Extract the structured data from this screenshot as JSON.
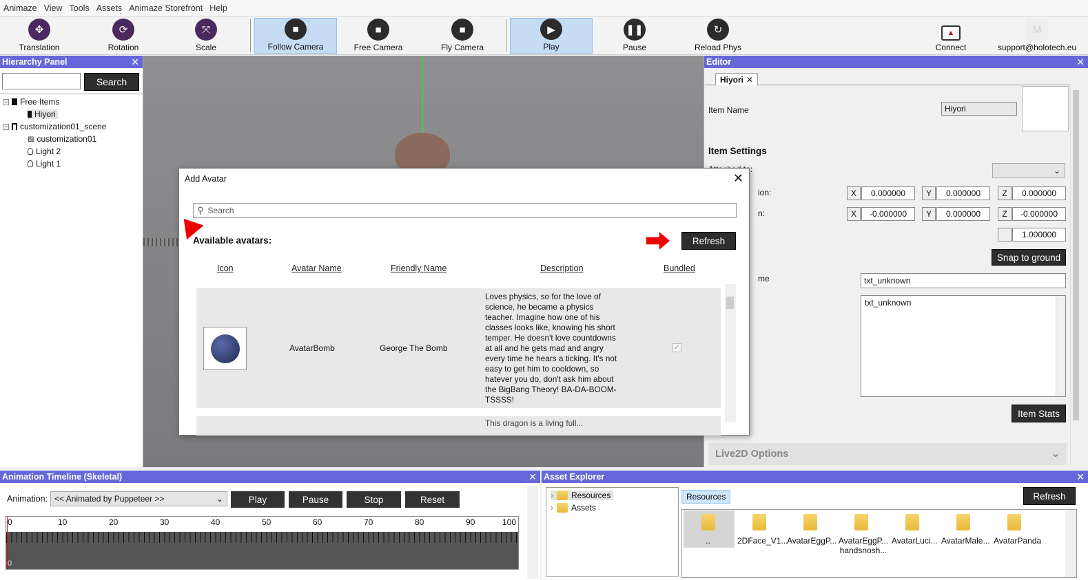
{
  "menu": [
    "Animaze",
    "View",
    "Tools",
    "Assets",
    "Animaze Storefront",
    "Help"
  ],
  "toolbar": {
    "translation": "Translation",
    "rotation": "Rotation",
    "scale": "Scale",
    "follow_camera": "Follow Camera",
    "free_camera": "Free Camera",
    "fly_camera": "Fly Camera",
    "play": "Play",
    "pause": "Pause",
    "reload_phys": "Reload Phys",
    "connect": "Connect",
    "user": "support@holotech.eu"
  },
  "hierarchy": {
    "title": "Hierarchy Panel",
    "search_label": "Search",
    "items": [
      "Free Items",
      "Hiyori",
      "customization01_scene",
      "customization01",
      "Light 2",
      "Light 1"
    ]
  },
  "editor": {
    "title": "Editor",
    "tab": "Hiyori",
    "item_name_label": "Item Name",
    "item_name_value": "Hiyori",
    "item_settings": "Item Settings",
    "attached_to": "Attached to:",
    "position_label": "ion:",
    "rotation_label": "n:",
    "pos": {
      "x": "0.000000",
      "y": "0.000000",
      "z": "0.000000"
    },
    "rot": {
      "x": "-0.000000",
      "y": "0.000000",
      "z": "-0.000000"
    },
    "scale_value": "1.000000",
    "snap": "Snap to ground",
    "name_label": "me",
    "txt_field": "txt_unknown",
    "txt_area": "txt_unknown",
    "item_stats": "Item Stats",
    "live2d": "Live2D Options",
    "axis": {
      "x": "X",
      "y": "Y",
      "z": "Z"
    }
  },
  "dialog": {
    "title": "Add Avatar",
    "search_placeholder": "Search",
    "available": "Available avatars:",
    "refresh": "Refresh",
    "columns": [
      "Icon",
      "Avatar Name",
      "Friendly Name",
      "Description",
      "Bundled"
    ],
    "row1": {
      "avatar_name": "AvatarBomb",
      "friendly_name": "George The Bomb",
      "description": "Loves physics, so for the love of science, he became a physics teacher. Imagine how one of his classes looks like, knowing his short temper. He doesn't love countdowns at all and he gets mad and angry every time he hears a ticking. It's not easy to get him to cooldown, so hatever you do, don't ask him about the BigBang Theory! BA-DA-BOOM-TSSSS!"
    },
    "row2_partial": "This dragon is a living full..."
  },
  "timeline": {
    "title": "Animation Timeline (Skeletal)",
    "animation_label": "Animation:",
    "animation_value": "<< Animated by Puppeteer >>",
    "play": "Play",
    "pause": "Pause",
    "stop": "Stop",
    "reset": "Reset",
    "ticks": [
      "0",
      "10",
      "20",
      "30",
      "40",
      "50",
      "60",
      "70",
      "80",
      "90",
      "100"
    ],
    "bottom_tick": "0"
  },
  "asset_explorer": {
    "title": "Asset Explorer",
    "tree": [
      "Resources",
      "Assets"
    ],
    "breadcrumb": "Resources",
    "refresh": "Refresh",
    "folders": [
      "..",
      "2DFace_V1...",
      "AvatarEggP...",
      "AvatarEggP... handsnosh...",
      "AvatarLuci...",
      "AvatarMale...",
      "AvatarPanda"
    ]
  },
  "colors": {
    "panel_header": "#6667d8",
    "active_tool": "#c6dcf4",
    "dark_button": "#2d2d2d"
  }
}
